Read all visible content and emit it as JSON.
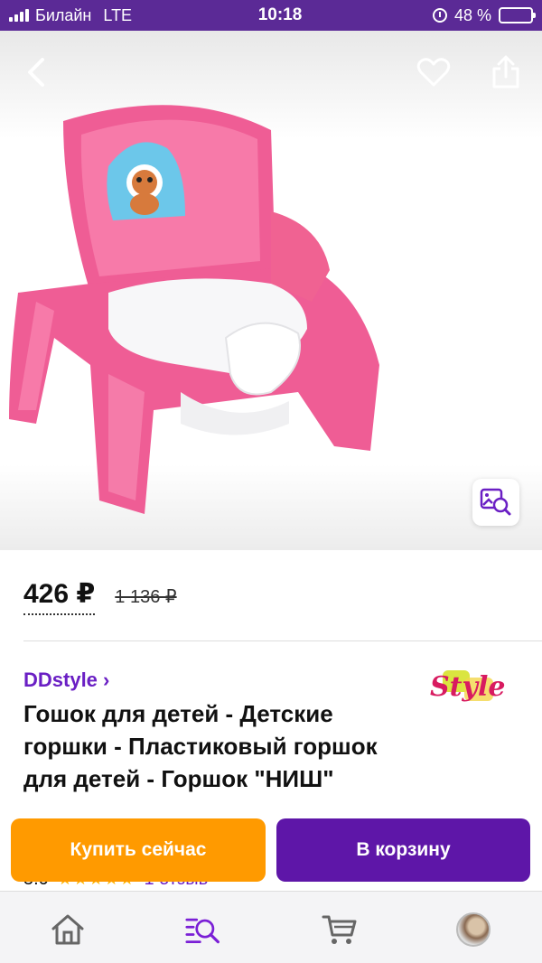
{
  "status_bar": {
    "carrier": "Билайн",
    "network": "LTE",
    "time": "10:18",
    "battery": "48 %",
    "battery_level": 0.48
  },
  "header": {
    "back_icon": "chevron-left-icon",
    "favorite_icon": "heart-icon",
    "share_icon": "share-icon",
    "zoom_icon": "image-search-icon"
  },
  "product": {
    "price": "426 ₽",
    "old_price": "1 136 ₽",
    "seller": "DDstyle ›",
    "brand_logo_text": "Style",
    "title": "Гошок для детей - Детские горшки - Пластиковый горшок для детей - Горшок \"НИШ\"",
    "rating": "5.0",
    "stars": "★★★★★",
    "reviews": "1 отзыв"
  },
  "actions": {
    "buy_now": "Купить сейчас",
    "add_to_cart": "В корзину"
  },
  "bottom_nav": {
    "items": [
      "home-icon",
      "catalog-search-icon",
      "cart-icon",
      "profile-avatar"
    ]
  },
  "colors": {
    "status_bar": "#5b2a96",
    "accent": "#6a1fc4",
    "buy_button": "#ff9a00",
    "cart_button": "#5e16a8",
    "product_pink": "#f06292"
  }
}
